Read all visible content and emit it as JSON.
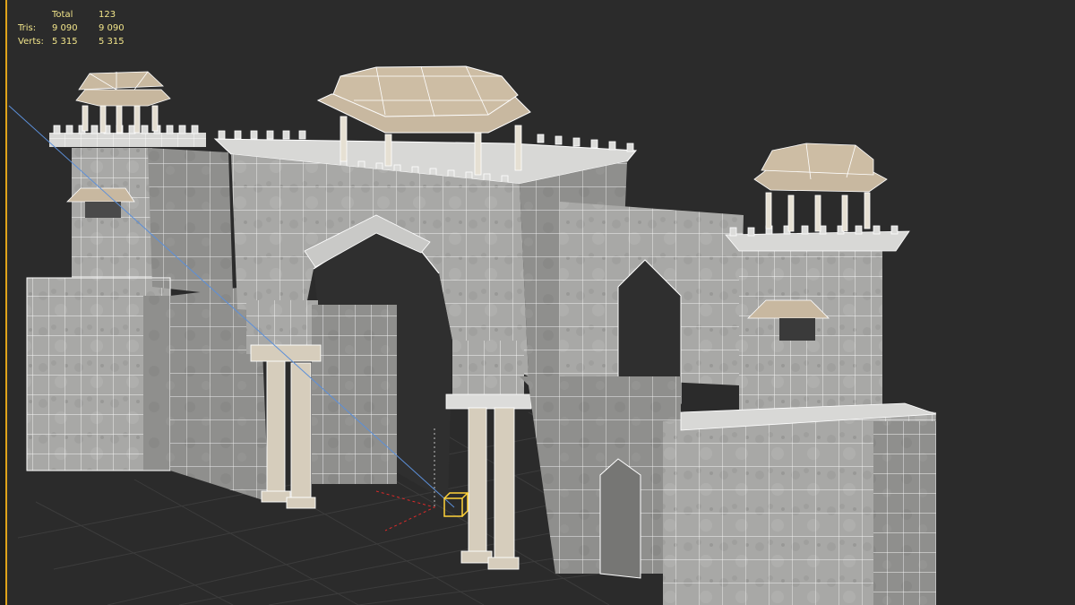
{
  "viewport": {
    "background": "#2b2b2b",
    "stats": {
      "columns": [
        "Total",
        "123"
      ],
      "rows": [
        {
          "label": "Tris:",
          "total": "9 090",
          "selected": "9 090"
        },
        {
          "label": "Verts:",
          "total": "5 315",
          "selected": "5 315"
        }
      ]
    },
    "colors": {
      "stats_text": "#f2e58a",
      "wireframe": "#ffffff",
      "stone": "#a9a9a7",
      "stone_dark": "#8d8d8b",
      "dome": "#c4b49b",
      "grid": "#3b3b3b",
      "selection_gizmo": "#ffd23a",
      "axis_x": "#d92a2a",
      "axis_z": "#5c8fd8",
      "active_border": "#e0a31b"
    },
    "model": "stone gateway with three domed chhatri towers and pointed arches"
  }
}
